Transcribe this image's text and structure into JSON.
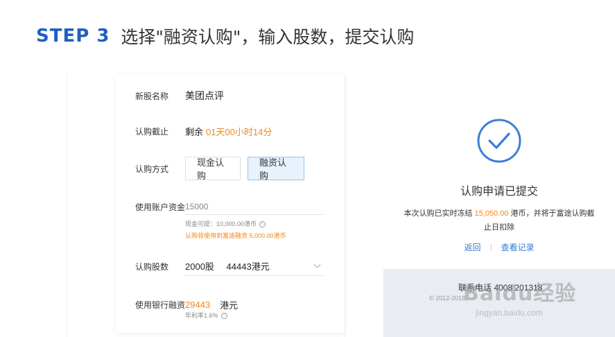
{
  "header": {
    "step": "STEP 3",
    "title": "选择\"融资认购\"，输入股数，提交认购"
  },
  "form": {
    "stock_name_label": "新股名称",
    "stock_name_value": "美团点评",
    "deadline_label": "认购截止",
    "deadline_prefix": "剩余",
    "deadline_value": "01天00小时14分",
    "method_label": "认购方式",
    "method_cash": "现金认购",
    "method_financing": "融资认购",
    "account_label": "使用账户资金",
    "account_value": "15000",
    "cash_available": "现金可提：10,000.00港币",
    "financing_hint": "认购将使用到富途融资 5,000.00港币",
    "shares_label": "认购股数",
    "shares_value": "2000股",
    "shares_amount": "44443港元",
    "bank_label": "使用银行融资",
    "bank_value": "29443",
    "bank_unit": "港元",
    "rate": "年利率1.6%"
  },
  "result": {
    "title": "认购申请已提交",
    "desc_prefix": "本次认购已实时冻结",
    "desc_amount": "15,050.00",
    "desc_suffix": "港币，并将于富途认购截止日扣除",
    "back": "返回",
    "view_records": "查看记录",
    "contact": "联系电话 4008 201318",
    "copyright": "© 2012-2018"
  },
  "watermark": {
    "main": "Baidu经验",
    "sub": "jingyan.baidu.com"
  },
  "colors": {
    "accent": "#1f5fbf",
    "orange": "#f0861a",
    "link": "#2f7bd6",
    "check": "#3b7dd8"
  }
}
